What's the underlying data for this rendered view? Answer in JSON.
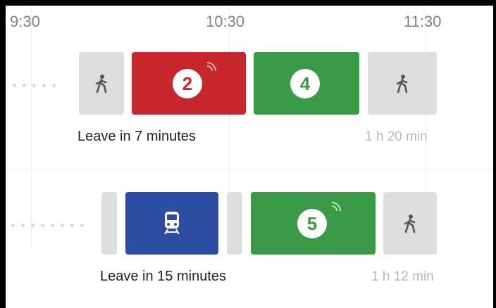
{
  "timeline": {
    "labels": [
      "9:30",
      "10:30",
      "11:30"
    ]
  },
  "trips": [
    {
      "leave_text": "Leave in 7 minutes",
      "duration": "1 h 20 min",
      "routes": [
        {
          "number": "2",
          "color": "#c5272d",
          "live": true
        },
        {
          "number": "4",
          "color": "#3a9a47",
          "live": false
        }
      ]
    },
    {
      "leave_text": "Leave in 15 minutes",
      "duration": "1 h 12 min",
      "rail_color": "#2d4da3",
      "routes": [
        {
          "number": "5",
          "color": "#3a9a47",
          "live": true
        }
      ]
    }
  ],
  "icons": {
    "walk": "walk-icon",
    "train": "train-icon",
    "live": "realtime-icon"
  }
}
